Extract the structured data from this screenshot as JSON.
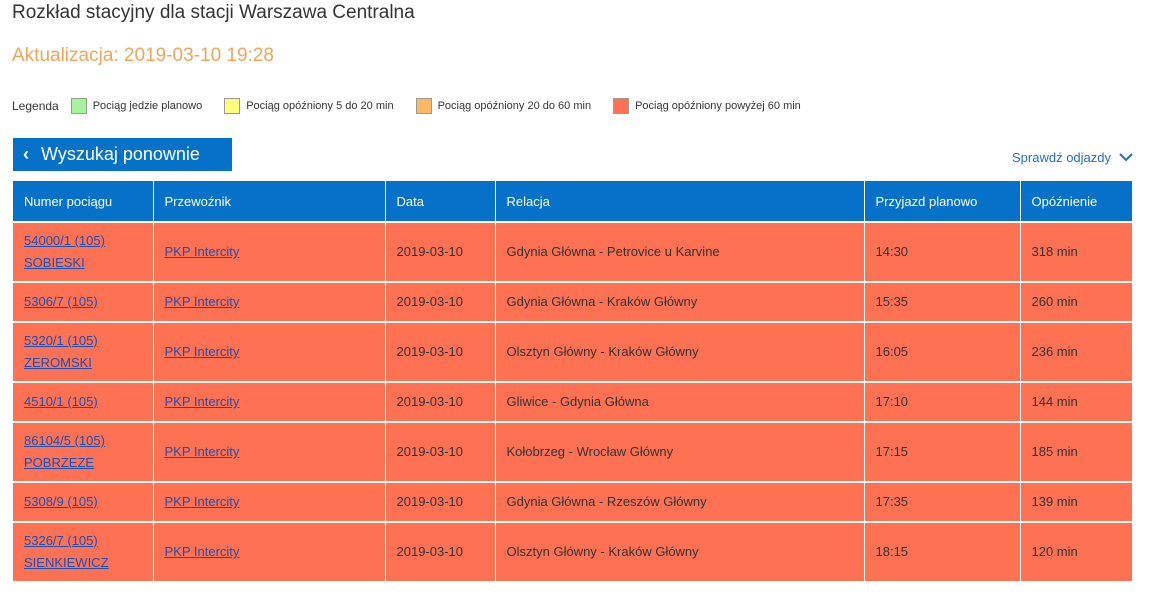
{
  "header": {
    "title": "Rozkład stacyjny dla stacji Warszawa Centralna",
    "update": "Aktualizacja: 2019-03-10 19:28"
  },
  "legend": {
    "label": "Legenda",
    "items": [
      {
        "label": "Pociąg jedzie planowo",
        "color": "#a7f39b"
      },
      {
        "label": "Pociąg opóźniony 5 do 20 min",
        "color": "#fffe7a"
      },
      {
        "label": "Pociąg opóźniony 20 do 60 min",
        "color": "#fdb865"
      },
      {
        "label": "Pociąg opóźniony powyżej 60 min",
        "color": "#fe7152"
      }
    ]
  },
  "actions": {
    "search_again": "Wyszukaj ponownie",
    "check_departures": "Sprawdź odjazdy"
  },
  "table": {
    "columns": [
      "Numer pociągu",
      "Przewoźnik",
      "Data",
      "Relacja",
      "Przyjazd planowo",
      "Opóźnienie"
    ],
    "rows": [
      {
        "number": "54000/1 (105)",
        "name": "SOBIESKI",
        "carrier": "PKP Intercity",
        "date": "2019-03-10",
        "route": "Gdynia Główna - Petrovice u Karvine",
        "arrival": "14:30",
        "delay": "318 min"
      },
      {
        "number": "5306/7 (105)",
        "name": "",
        "carrier": "PKP Intercity",
        "date": "2019-03-10",
        "route": "Gdynia Główna - Kraków Główny",
        "arrival": "15:35",
        "delay": "260 min"
      },
      {
        "number": "5320/1 (105)",
        "name": "ZEROMSKI",
        "carrier": "PKP Intercity",
        "date": "2019-03-10",
        "route": "Olsztyn Główny - Kraków Główny",
        "arrival": "16:05",
        "delay": "236 min"
      },
      {
        "number": "4510/1 (105)",
        "name": "",
        "carrier": "PKP Intercity",
        "date": "2019-03-10",
        "route": "Gliwice - Gdynia Główna",
        "arrival": "17:10",
        "delay": "144 min"
      },
      {
        "number": "86104/5 (105)",
        "name": "POBRZEZE",
        "carrier": "PKP Intercity",
        "date": "2019-03-10",
        "route": "Kołobrzeg - Wrocław Główny",
        "arrival": "17:15",
        "delay": "185 min"
      },
      {
        "number": "5308/9 (105)",
        "name": "",
        "carrier": "PKP Intercity",
        "date": "2019-03-10",
        "route": "Gdynia Główna - Rzeszów Główny",
        "arrival": "17:35",
        "delay": "139 min"
      },
      {
        "number": "5326/7 (105)",
        "name": "SIENKIEWICZ",
        "carrier": "PKP Intercity",
        "date": "2019-03-10",
        "route": "Olsztyn Główny - Kraków Główny",
        "arrival": "18:15",
        "delay": "120 min"
      }
    ]
  }
}
